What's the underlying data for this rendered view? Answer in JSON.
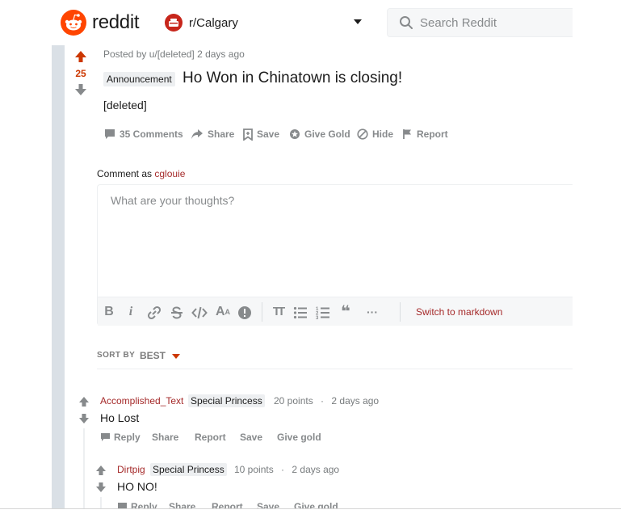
{
  "header": {
    "brand": "reddit",
    "subreddit": "r/Calgary",
    "search_placeholder": "Search Reddit"
  },
  "post": {
    "votes": "25",
    "posted_by": "Posted by u/[deleted] 2 days ago",
    "flair": "Announcement",
    "title": "Ho Won in Chinatown is closing!",
    "body": "[deleted]",
    "actions": {
      "comments": "35 Comments",
      "share": "Share",
      "save": "Save",
      "give_gold": "Give Gold",
      "hide": "Hide",
      "report": "Report"
    }
  },
  "comment_box": {
    "label": "Comment as",
    "username": "cglouie",
    "placeholder": "What are your thoughts?",
    "switch_markdown": "Switch to markdown",
    "tools": {
      "bold": "B",
      "italic": "i",
      "superscript": "A",
      "superscript_small": "A",
      "heading": "TT",
      "quote": "❝",
      "more": "···"
    }
  },
  "sort": {
    "label": "SORT BY",
    "value": "BEST"
  },
  "comments": [
    {
      "author": "Accomplished_Text",
      "flair": "Special Princess",
      "points": "20 points",
      "sep": "·",
      "time": "2 days ago",
      "text": "Ho Lost",
      "actions": {
        "reply": "Reply",
        "share": "Share",
        "report": "Report",
        "save": "Save",
        "give_gold": "Give gold"
      }
    },
    {
      "author": "Dirtpig",
      "flair": "Special Princess",
      "points": "10 points",
      "sep": "·",
      "time": "2 days ago",
      "text": "HO NO!",
      "actions": {
        "reply": "Reply",
        "share": "Share",
        "report": "Report",
        "save": "Save",
        "give_gold": "Give gold"
      }
    }
  ],
  "colors": {
    "brand_orange": "#ff4500",
    "upvote": "#cc3700",
    "link_red": "#a52a2a",
    "muted": "#878a8c",
    "gutter": "#dae0e6"
  }
}
